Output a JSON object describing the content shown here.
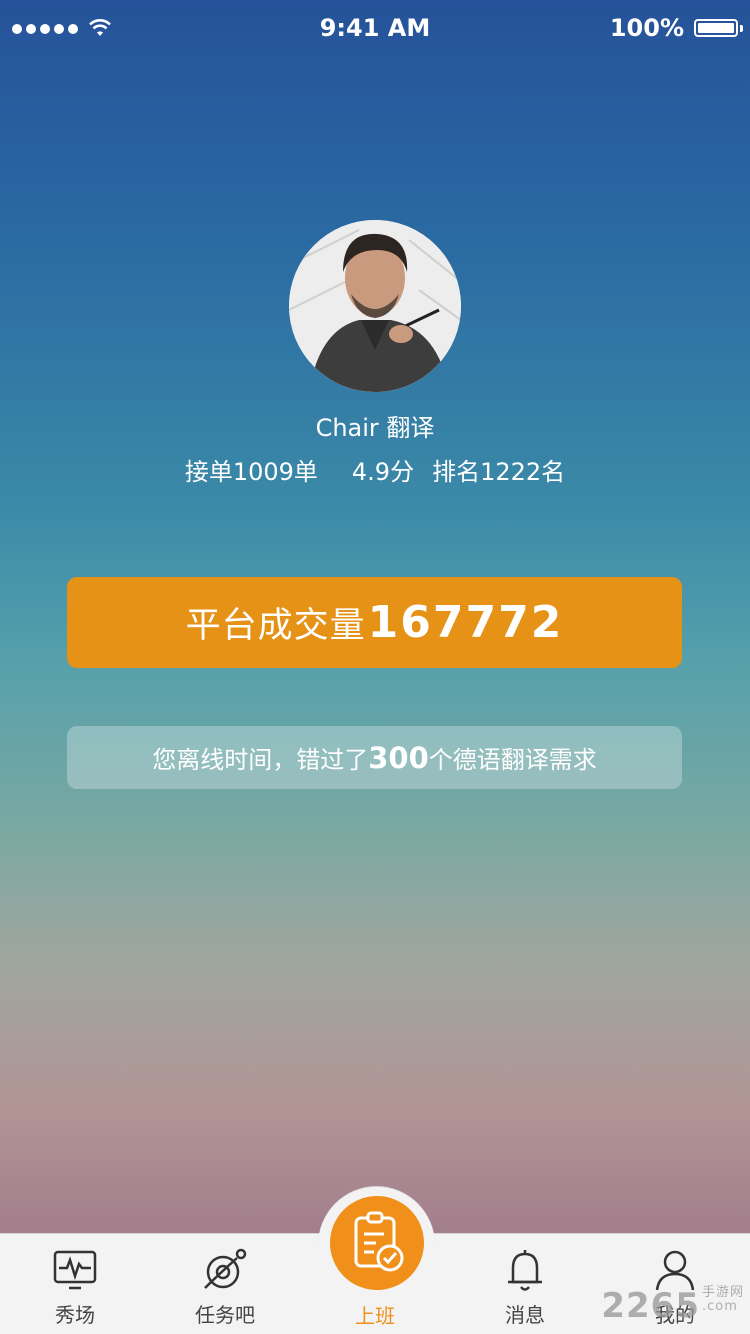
{
  "status_bar": {
    "time": "9:41 AM",
    "battery": "100%"
  },
  "profile": {
    "name": "Chair 翻译",
    "orders": "接单1009单",
    "score": "4.9分",
    "rank": "排名1222名"
  },
  "platform": {
    "label": "平台成交量",
    "value": "167772"
  },
  "missed": {
    "prefix": "您离线时间，错过了",
    "count": "300",
    "suffix": "个德语翻译需求"
  },
  "tabs": [
    {
      "label": "秀场",
      "icon": "pulse-monitor-icon"
    },
    {
      "label": "任务吧",
      "icon": "planet-icon"
    },
    {
      "label": "上班",
      "icon": "clipboard-check-icon"
    },
    {
      "label": "消息",
      "icon": "bell-icon"
    },
    {
      "label": "我的",
      "icon": "user-icon"
    }
  ],
  "watermark": {
    "text": "2265",
    "suffix_top": "手游网",
    "suffix_bottom": ".com"
  },
  "colors": {
    "accent": "#e69217",
    "tab_active": "#f0901a"
  }
}
